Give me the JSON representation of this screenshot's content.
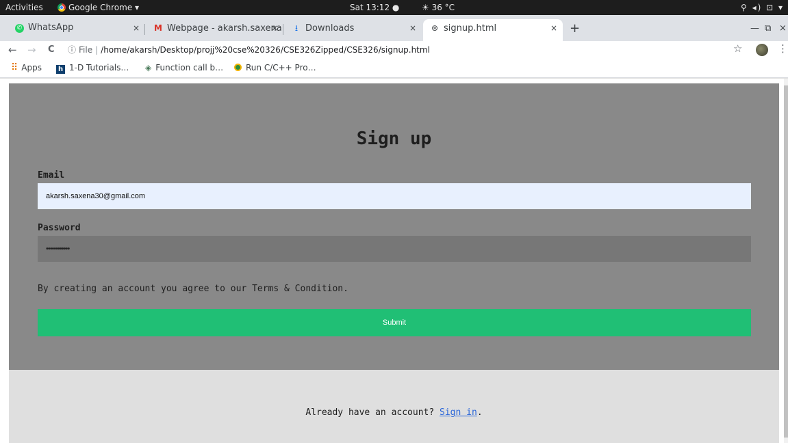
{
  "system_bar": {
    "activities": "Activities",
    "app_name": "Google Chrome ▾",
    "clock": "Sat 13:12 ●",
    "weather": "☀ 36 °C",
    "tray": "⚲ ◂) ⊡ ▾"
  },
  "tabs": [
    {
      "icon": "whatsapp-icon",
      "label": "WhatsApp",
      "close": "×"
    },
    {
      "icon": "gmail-icon",
      "label": "Webpage - akarsh.saxena",
      "close": "×"
    },
    {
      "icon": "download-icon",
      "label": "Downloads",
      "close": "×"
    },
    {
      "icon": "globe-icon",
      "label": "signup.html",
      "close": "×"
    }
  ],
  "toolbar": {
    "back": "←",
    "forward": "→",
    "reload": "C",
    "info": "ⓘ",
    "scheme": "File",
    "url": "/home/akarsh/Desktop/projj%20cse%20326/CSE326Zipped/CSE326/signup.html",
    "star": "☆",
    "menu": "⋮",
    "new_tab": "+",
    "minimize": "—",
    "restore": "⧉",
    "close": "×"
  },
  "bookmarks": [
    {
      "label": "Apps"
    },
    {
      "label": "1-D Tutorials…"
    },
    {
      "label": "Function call b…"
    },
    {
      "label": "Run C/C++ Pro…"
    }
  ],
  "page": {
    "title": "Sign up",
    "email_label": "Email",
    "email_value": "akarsh.saxena30@gmail.com",
    "password_label": "Password",
    "password_value": "••••••••••••",
    "terms": "By creating an account you agree to our Terms & Condition.",
    "submit_label": "Submit",
    "signin_prefix": "Already have an account? ",
    "signin_link": "Sign in",
    "signin_suffix": "."
  },
  "colors": {
    "form_background": "#898989",
    "footer_background": "#dfdfdf",
    "submit_green": "#20bf75",
    "email_autofill": "#e8f0fe",
    "link_blue": "#2a66d9"
  }
}
